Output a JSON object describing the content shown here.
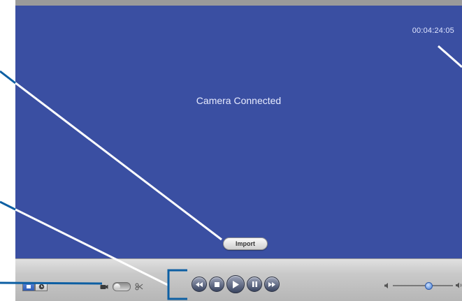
{
  "viewer": {
    "status_text": "Camera Connected",
    "timecode": "00:04:24:05",
    "import_label": "Import",
    "background_color": "#3a4fa2"
  },
  "controls": {
    "mode_buttons": [
      {
        "icon": "camera-mode-icon",
        "active": true
      },
      {
        "icon": "clock-mode-icon",
        "active": false
      }
    ],
    "switch": {
      "left_icon": "camera-icon",
      "right_icon": "scissors-icon"
    },
    "transport": [
      {
        "icon": "rewind-icon"
      },
      {
        "icon": "stop-icon"
      },
      {
        "icon": "play-icon"
      },
      {
        "icon": "pause-icon"
      },
      {
        "icon": "fast-forward-icon"
      }
    ],
    "volume": {
      "level": 0.58,
      "low_icon": "speaker-low-icon",
      "high_icon": "speaker-high-icon"
    }
  },
  "colors": {
    "callout": "#0d5fa3",
    "transport_button": "#3a4561",
    "volume_knob": "#3f79d2"
  }
}
